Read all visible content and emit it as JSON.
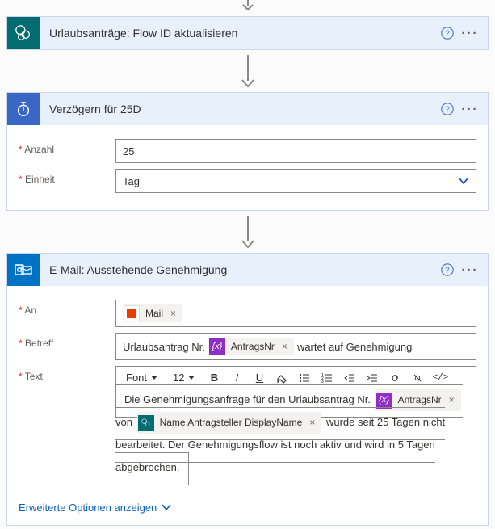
{
  "steps": {
    "sharepoint": {
      "title": "Urlaubsanträge: Flow ID aktualisieren"
    },
    "delay": {
      "title": "Verzögern für 25D",
      "fields": {
        "count_label": "Anzahl",
        "count_value": "25",
        "unit_label": "Einheit",
        "unit_value": "Tag"
      }
    },
    "email": {
      "title": "E-Mail: Ausstehende Genehmigung",
      "to_label": "An",
      "to_token": "Mail",
      "subject_label": "Betreff",
      "subject_pre": "Urlaubsantrag Nr.",
      "subject_token": "AntragsNr",
      "subject_post": "wartet auf Genehmigung",
      "body_label": "Text",
      "rte": {
        "font": "Font",
        "size": "12"
      },
      "body": {
        "p1_pre": "Die Genehmigungsanfrage für den Urlaubsantrag Nr.",
        "p1_token": "AntragsNr",
        "p2_pre": "von",
        "p2_token": "Name Antragsteller DisplayName",
        "p2_post": "wurde seit 25 Tagen nicht bearbeitet. Der Genehmigungsflow ist noch aktiv und wird in 5 Tagen abgebrochen."
      },
      "advanced": "Erweiterte Optionen anzeigen"
    }
  }
}
